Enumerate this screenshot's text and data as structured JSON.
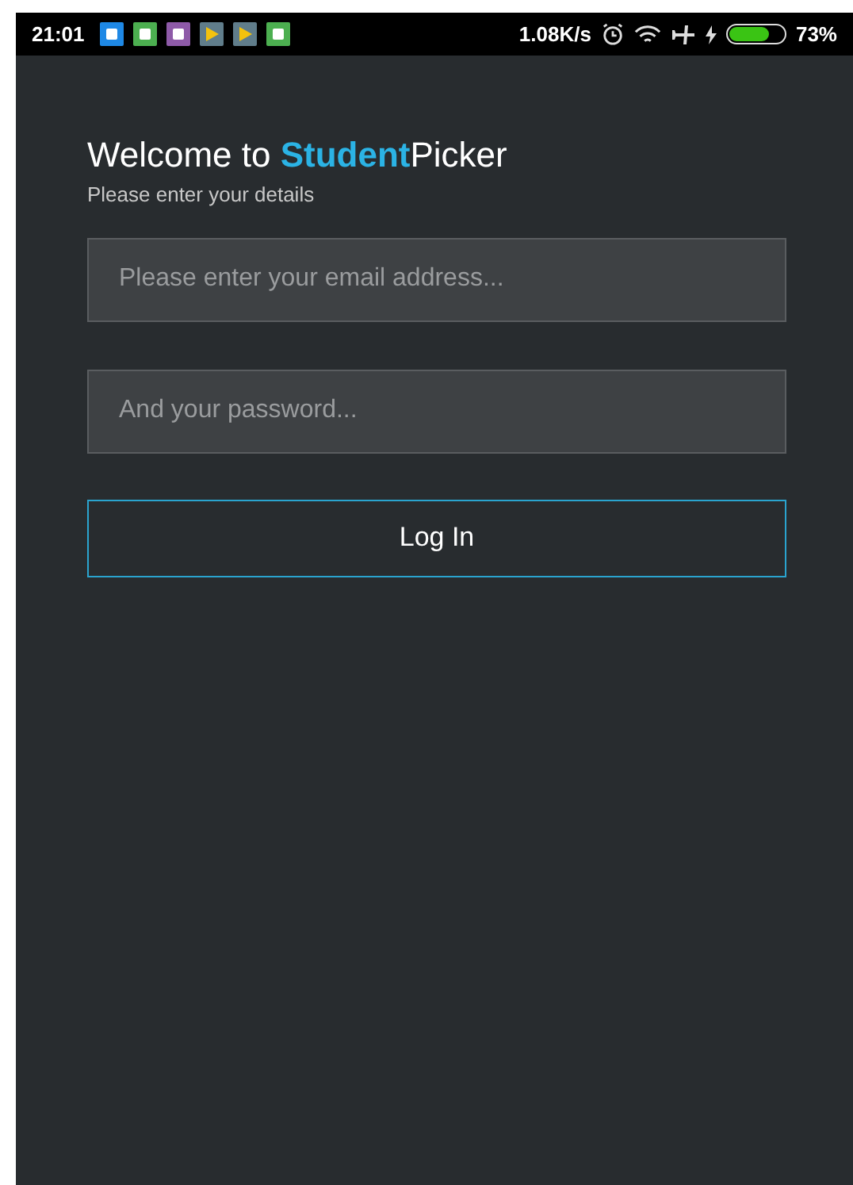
{
  "status_bar": {
    "time": "21:01",
    "notification_icons": [
      {
        "kind": "app",
        "color": "#1e88e5"
      },
      {
        "kind": "app",
        "color": "#4caf50"
      },
      {
        "kind": "app",
        "color": "#8e5aa8"
      },
      {
        "kind": "play",
        "color": "#607d8b"
      },
      {
        "kind": "play",
        "color": "#607d8b"
      },
      {
        "kind": "app",
        "color": "#4caf50"
      }
    ],
    "speed": "1.08K/s",
    "battery": {
      "level": 0.73,
      "text": "73%"
    }
  },
  "header": {
    "title_start": "Welcome to ",
    "title_highlight": "Student",
    "title_end": "Picker",
    "subtitle": "Please enter your details"
  },
  "fields": [
    {
      "placeholder": "Please enter your email address..."
    },
    {
      "placeholder": "And your password..."
    }
  ],
  "button": "Log In"
}
